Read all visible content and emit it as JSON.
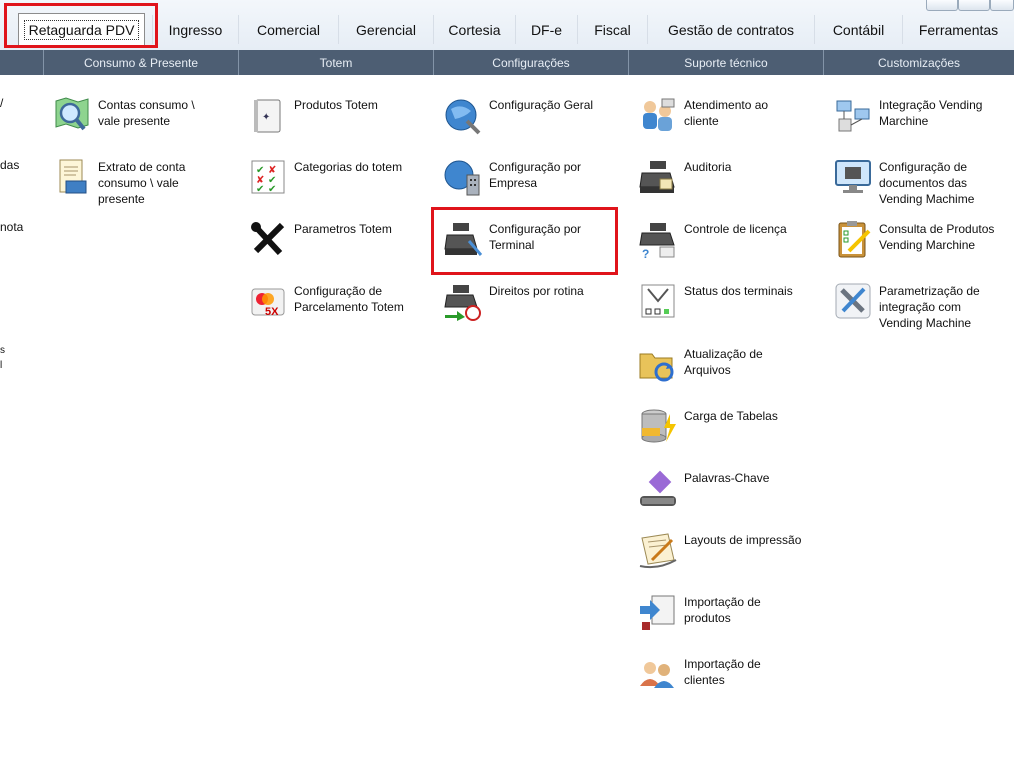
{
  "tabs": [
    {
      "id": "retaguarda",
      "label": "Retaguarda PDV",
      "active": true
    },
    {
      "id": "ingresso",
      "label": "Ingresso"
    },
    {
      "id": "comercial",
      "label": "Comercial"
    },
    {
      "id": "gerencial",
      "label": "Gerencial"
    },
    {
      "id": "cortesia",
      "label": "Cortesia"
    },
    {
      "id": "dfe",
      "label": "DF-e"
    },
    {
      "id": "fiscal",
      "label": "Fiscal"
    },
    {
      "id": "gestao",
      "label": "Gestão de contratos"
    },
    {
      "id": "contabil",
      "label": "Contábil"
    },
    {
      "id": "ferramentas",
      "label": "Ferramentas"
    }
  ],
  "sections": [
    "",
    "Consumo & Presente",
    "Totem",
    "Configurações",
    "Suporte técnico",
    "Customizações"
  ],
  "partial_left": [
    "/",
    "das",
    "nota",
    "s",
    "l"
  ],
  "items": {
    "consumo": [
      {
        "label": "Contas consumo \\ vale presente",
        "icon": "map-magnifier-icon"
      },
      {
        "label": "Extrato de conta consumo \\ vale presente",
        "icon": "statement-icon"
      }
    ],
    "totem": [
      {
        "label": "Produtos Totem",
        "icon": "products-book-icon"
      },
      {
        "label": "Categorias do totem",
        "icon": "categories-grid-icon"
      },
      {
        "label": "Parametros Totem",
        "icon": "tools-icon"
      },
      {
        "label": "Configuração de Parcelamento Totem",
        "icon": "credit-card-5x-icon"
      }
    ],
    "config": [
      {
        "label": "Configuração Geral",
        "icon": "globe-tools-icon"
      },
      {
        "label": "Configuração por Empresa",
        "icon": "globe-building-icon"
      },
      {
        "label": "Configuração por Terminal",
        "icon": "cash-register-icon"
      },
      {
        "label": "Direitos por rotina",
        "icon": "register-clock-icon"
      }
    ],
    "suporte": [
      {
        "label": "Atendimento ao cliente",
        "icon": "support-people-icon"
      },
      {
        "label": "Auditoria",
        "icon": "register-audit-icon"
      },
      {
        "label": "Controle de licença",
        "icon": "register-license-icon"
      },
      {
        "label": "Status dos terminais",
        "icon": "terminal-status-icon"
      },
      {
        "label": "Atualização de Arquivos",
        "icon": "folder-refresh-icon"
      },
      {
        "label": "Carga de Tabelas",
        "icon": "database-load-icon"
      },
      {
        "label": "Palavras-Chave",
        "icon": "key-abc-icon"
      },
      {
        "label": "Layouts de impressão",
        "icon": "print-layout-icon"
      },
      {
        "label": "Importação de produtos",
        "icon": "import-products-icon"
      },
      {
        "label": "Importação de clientes",
        "icon": "import-clients-icon"
      }
    ],
    "custom": [
      {
        "label": "Integração Vending Marchine",
        "icon": "network-computers-icon"
      },
      {
        "label": "Configuração de documentos das Vending Machime",
        "icon": "monitor-register-icon"
      },
      {
        "label": "Consulta de Produtos Vending Marchine",
        "icon": "clipboard-pencil-icon"
      },
      {
        "label": "Parametrização de integração com Vending Machine",
        "icon": "wrench-screwdriver-icon"
      }
    ]
  },
  "colors": {
    "section_bg": "#4d5e73",
    "highlight": "#e0141b"
  }
}
